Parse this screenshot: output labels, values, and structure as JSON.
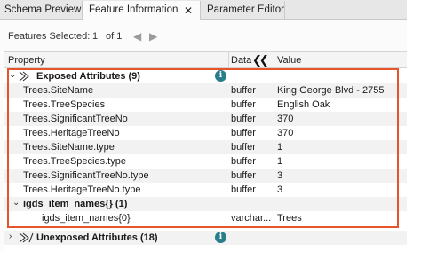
{
  "tabs": [
    {
      "label": "Schema Preview"
    },
    {
      "label": "Feature Information",
      "close": "✕"
    },
    {
      "label": "Parameter Editor"
    }
  ],
  "toolbar": {
    "features_selected_label": "Features Selected:",
    "current": "1",
    "of_total": "of 1",
    "prev": "◀",
    "next": "▶"
  },
  "columns": {
    "property": "Property",
    "data": "Data",
    "collapse": "❮❮",
    "value": "Value"
  },
  "exposed_group": {
    "label": "Exposed Attributes (9)",
    "info": "i"
  },
  "exposed_rows": [
    {
      "property": "Trees.SiteName",
      "data": "buffer",
      "value": "King George Blvd - 2755"
    },
    {
      "property": "Trees.TreeSpecies",
      "data": "buffer",
      "value": "English Oak"
    },
    {
      "property": "Trees.SignificantTreeNo",
      "data": "buffer",
      "value": "370"
    },
    {
      "property": "Trees.HeritageTreeNo",
      "data": "buffer",
      "value": "370"
    },
    {
      "property": "Trees.SiteName.type",
      "data": "buffer",
      "value": "1"
    },
    {
      "property": "Trees.TreeSpecies.type",
      "data": "buffer",
      "value": "1"
    },
    {
      "property": "Trees.SignificantTreeNo.type",
      "data": "buffer",
      "value": "3"
    },
    {
      "property": "Trees.HeritageTreeNo.type",
      "data": "buffer",
      "value": "3"
    }
  ],
  "igds_group": {
    "label": "igds_item_names{} (1)"
  },
  "igds_row": {
    "property": "igds_item_names{0}",
    "data": "varchar...",
    "value": "Trees"
  },
  "unexposed_group": {
    "label": "Unexposed Attributes (18)",
    "info": "i"
  },
  "colors": {
    "highlight": "#e8542a",
    "info": "#2a7d8c"
  }
}
